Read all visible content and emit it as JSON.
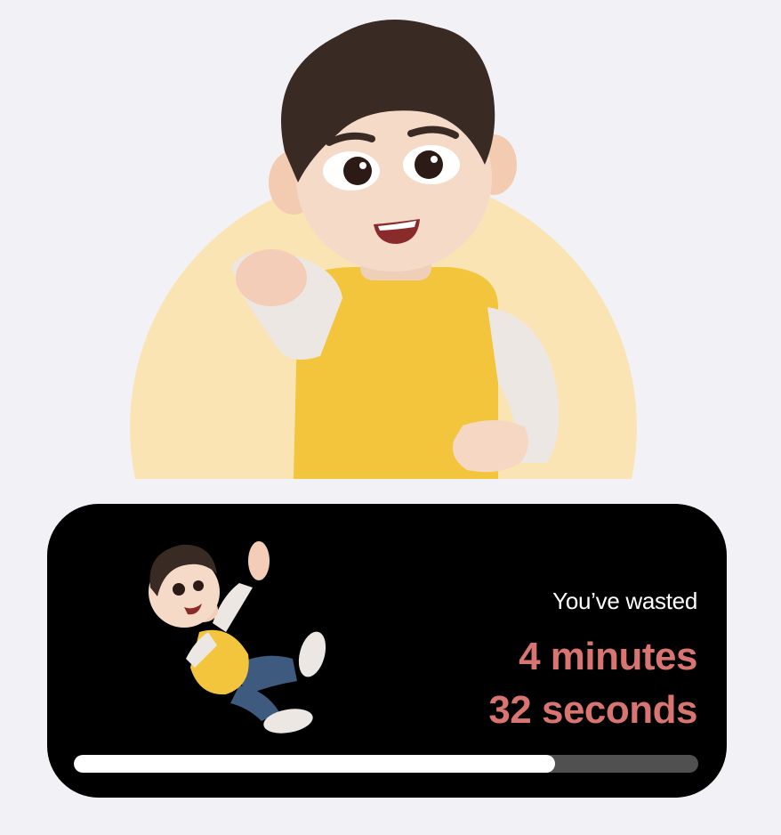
{
  "colors": {
    "background": "#f2f2f6",
    "card": "#000000",
    "accent": "#d97570",
    "circle": "#fbe4b4",
    "track": "#505050",
    "fill": "#ffffff"
  },
  "hero": {
    "illustration": "pointing-boy-illustration"
  },
  "card": {
    "illustration": "falling-boy-illustration",
    "label": "You’ve wasted",
    "minutes": "4 minutes",
    "seconds": "32 seconds",
    "progress": 0.77
  }
}
